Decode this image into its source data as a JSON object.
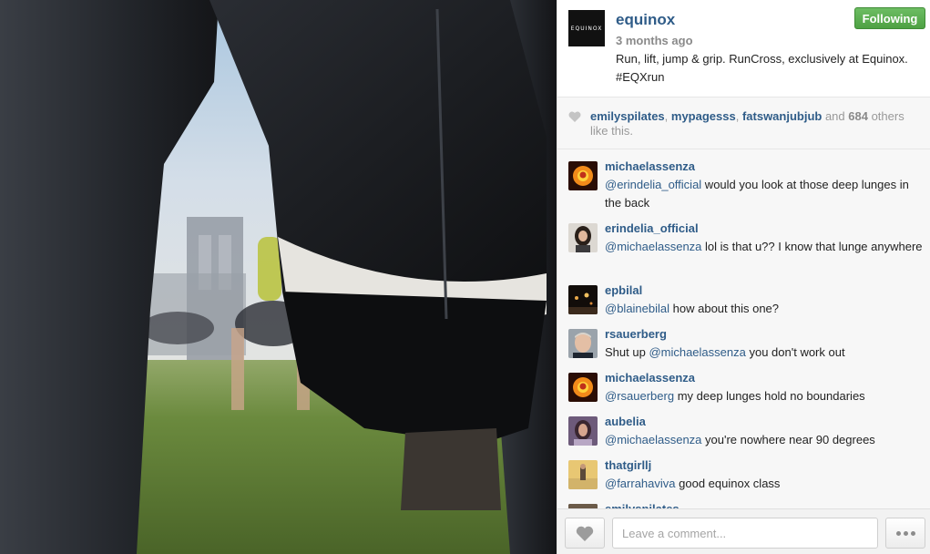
{
  "post": {
    "avatar_text": "EQUINOX",
    "username": "equinox",
    "timestamp": "3 months ago",
    "caption": "Run, lift, jump & grip. RunCross, exclusively at Equinox. #EQXrun",
    "follow_label": "Following",
    "follow_color": "#5cb052"
  },
  "likes": {
    "likers": [
      "emilyspilates",
      "mypagesss",
      "fatswanjubjub"
    ],
    "separator": ", ",
    "and_text": " and ",
    "count": "684",
    "suffix": " others like this."
  },
  "comments": [
    {
      "user": "michaelassenza",
      "mention": "@erindelia_official",
      "text": " would you look at those deep lunges in the back",
      "avatar": "orange-glow"
    },
    {
      "user": "erindelia_official",
      "mention": "@michaelassenza",
      "text": " lol is that u?? I know that lunge anywhere",
      "avatar": "woman-dark-hair"
    },
    {
      "user": "epbilal",
      "mention": "@blainebilal",
      "text": " how about this one?",
      "avatar": "night-lights"
    },
    {
      "user": "rsauerberg",
      "pre": "Shut up ",
      "mention": "@michaelassenza",
      "text": " you don't work out",
      "avatar": "man-portrait"
    },
    {
      "user": "michaelassenza",
      "mention": "@rsauerberg",
      "text": " my deep lunges hold no boundaries",
      "avatar": "orange-glow"
    },
    {
      "user": "aubelia",
      "mention": "@michaelassenza",
      "text": " you're nowhere near 90 degrees",
      "avatar": "purple-portrait"
    },
    {
      "user": "thatgirllj",
      "mention": "@farrahaviva",
      "text": " good equinox class",
      "avatar": "beach-photo"
    },
    {
      "user": "emilyspilates",
      "mention": "",
      "text": "",
      "avatar": "dark-photo"
    }
  ],
  "footer": {
    "comment_placeholder": "Leave a comment..."
  },
  "colors": {
    "link": "#2f5c88",
    "muted": "#8a8a8a"
  }
}
